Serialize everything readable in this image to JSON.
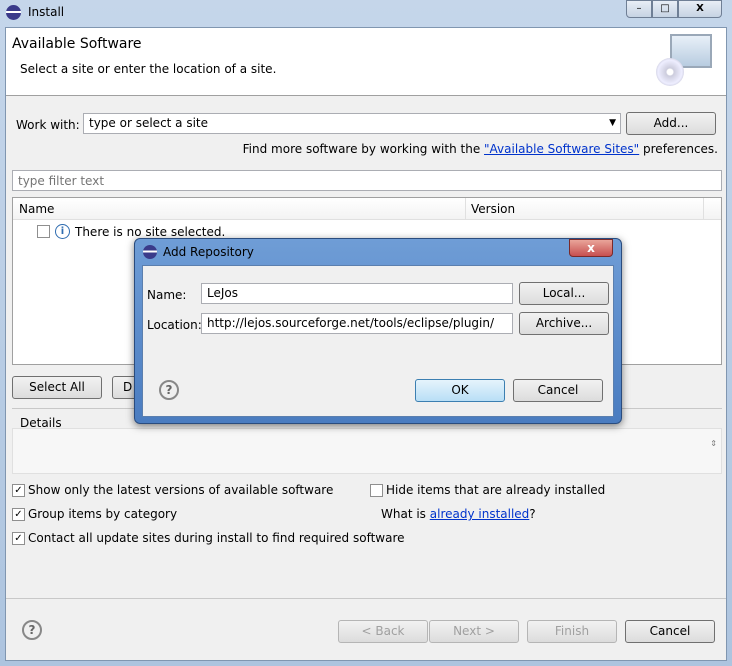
{
  "window": {
    "title": "Install",
    "controls": [
      "minimize",
      "maximize",
      "close"
    ]
  },
  "banner": {
    "title": "Available Software",
    "subtitle": "Select a site or enter the location of a site."
  },
  "work_with": {
    "label": "Work with:",
    "value": "type or select a site",
    "add_button": "Add...",
    "find_more_prefix": "Find more software by working with the ",
    "find_more_link": "\"Available Software Sites\"",
    "find_more_suffix": " preferences."
  },
  "filter": {
    "placeholder": "type filter text"
  },
  "table": {
    "columns": [
      "Name",
      "Version"
    ],
    "rows": [
      {
        "name": "There is no site selected.",
        "checked": false
      }
    ]
  },
  "buttons": {
    "select_all": "Select All",
    "deselect_all": "D"
  },
  "details": {
    "label": "Details"
  },
  "options": {
    "show_latest": {
      "label": "Show only the latest versions of available software",
      "checked": true
    },
    "hide_installed": {
      "label": "Hide items that are already installed",
      "checked": false
    },
    "group_by_category": {
      "label": "Group items by category",
      "checked": true
    },
    "what_is_prefix": "What is ",
    "what_is_link": "already installed",
    "what_is_suffix": "?",
    "contact_all": {
      "label": "Contact all update sites during install to find required software",
      "checked": true
    }
  },
  "footer": {
    "back": "< Back",
    "next": "Next >",
    "finish": "Finish",
    "cancel": "Cancel"
  },
  "dialog": {
    "title": "Add Repository",
    "name_label": "Name:",
    "name_value": "LeJos",
    "local_button": "Local...",
    "location_label": "Location:",
    "location_value": "http://lejos.sourceforge.net/tools/eclipse/plugin/",
    "archive_button": "Archive...",
    "ok": "OK",
    "cancel": "Cancel"
  },
  "colors": {
    "accent": "#0033cc",
    "close_button": "#c75050"
  }
}
